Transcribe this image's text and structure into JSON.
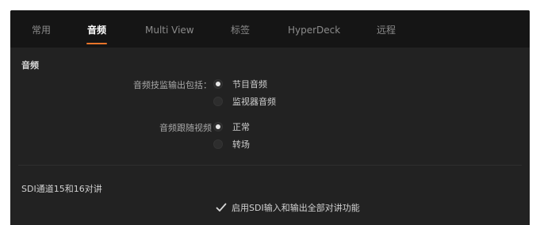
{
  "tabs": [
    {
      "label": "常用",
      "active": false
    },
    {
      "label": "音频",
      "active": true
    },
    {
      "label": "Multi View",
      "active": false
    },
    {
      "label": "标签",
      "active": false
    },
    {
      "label": "HyperDeck",
      "active": false
    },
    {
      "label": "远程",
      "active": false
    }
  ],
  "audio": {
    "title": "音频",
    "monitor_output": {
      "label": "音频技监输出包括：",
      "options": [
        {
          "label": "节目音频",
          "selected": true
        },
        {
          "label": "监视器音频",
          "selected": false
        }
      ]
    },
    "audio_follow_video": {
      "label": "音频跟随视频",
      "options": [
        {
          "label": "正常",
          "selected": true
        },
        {
          "label": "转场",
          "selected": false
        }
      ]
    }
  },
  "talkback": {
    "title": "SDI通道15和16对讲",
    "checkbox": {
      "label": "启用SDI输入和输出全部对讲功能",
      "checked": true
    }
  },
  "colors": {
    "accent": "#e8742a",
    "panel_bg": "#222222",
    "tabbar_bg": "#151515"
  }
}
